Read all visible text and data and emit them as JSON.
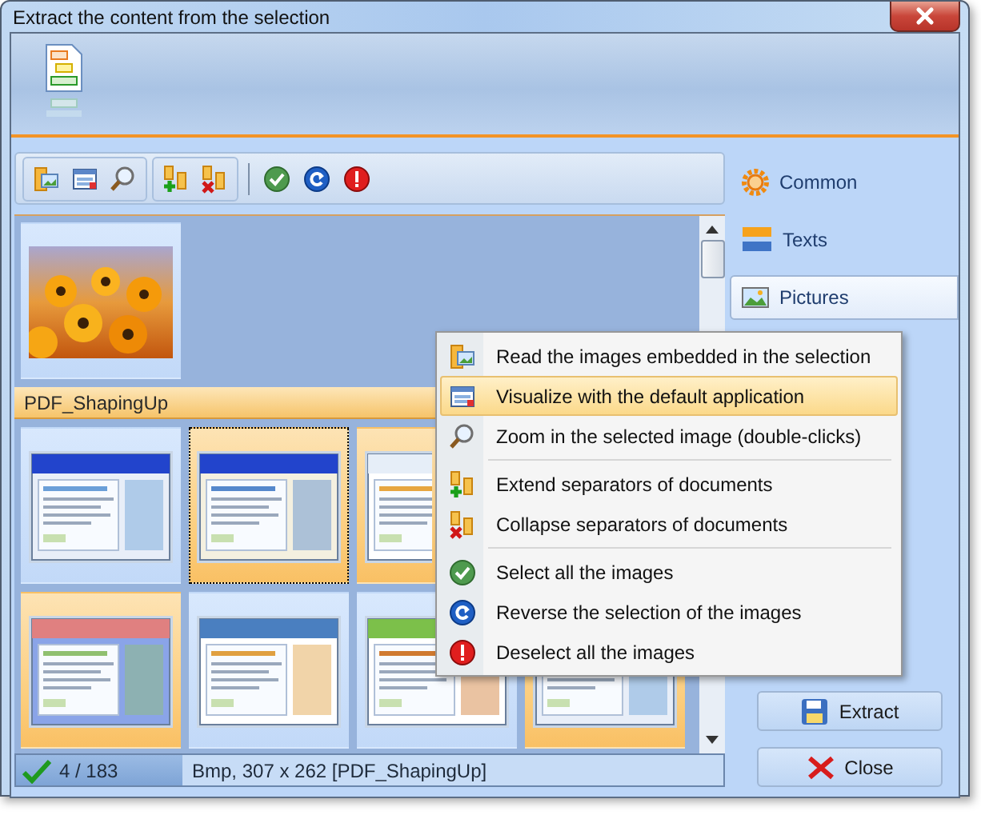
{
  "window": {
    "title": "Extract the content from the selection"
  },
  "sidebar": {
    "items": [
      {
        "label": "Common",
        "selected": false
      },
      {
        "label": "Texts",
        "selected": false
      },
      {
        "label": "Pictures",
        "selected": true
      }
    ]
  },
  "gallery": {
    "loose_images": [
      {
        "kind": "picture",
        "selected": false,
        "focused": false
      }
    ],
    "groups": [
      {
        "title": "PDF_ShapingUp",
        "rows": [
          [
            {
              "kind": "picture",
              "selected": false,
              "focused": false
            },
            {
              "kind": "picture",
              "selected": true,
              "focused": true
            },
            {
              "kind": "picture",
              "selected": true,
              "focused": false
            }
          ],
          [
            {
              "kind": "picture",
              "selected": true,
              "focused": false
            },
            {
              "kind": "picture",
              "selected": false,
              "focused": false
            },
            {
              "kind": "picture",
              "selected": false,
              "focused": false
            },
            {
              "kind": "picture",
              "selected": true,
              "focused": false
            }
          ]
        ]
      }
    ]
  },
  "context_menu": {
    "sections": [
      [
        {
          "label": "Read the images embedded in the selection",
          "selected": false
        },
        {
          "label": "Visualize with the default application",
          "selected": true
        },
        {
          "label": "Zoom in the selected image (double-clicks)",
          "selected": false
        }
      ],
      [
        {
          "label": "Extend separators of documents",
          "selected": false
        },
        {
          "label": "Collapse separators of documents",
          "selected": false
        }
      ],
      [
        {
          "label": "Select all the images",
          "selected": false
        },
        {
          "label": "Reverse the selection of the images",
          "selected": false
        },
        {
          "label": "Deselect all the images",
          "selected": false
        }
      ]
    ]
  },
  "status_bar": {
    "count": "4 / 183",
    "info": "Bmp, 307 x 262 [PDF_ShapingUp]"
  },
  "buttons": [
    {
      "label": "Extract",
      "kind": "save"
    },
    {
      "label": "Close",
      "kind": "close"
    }
  ]
}
